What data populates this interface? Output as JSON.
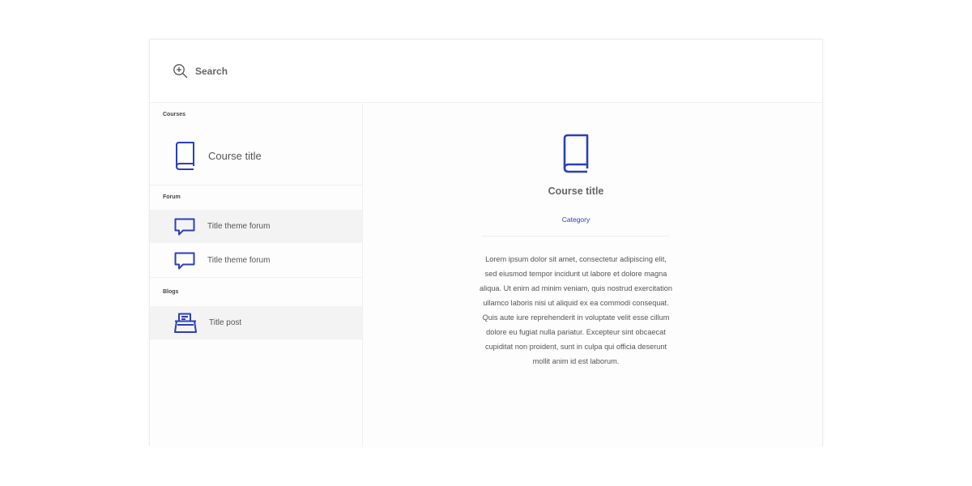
{
  "search": {
    "placeholder": "Search",
    "value": ""
  },
  "sidebar": {
    "courses": {
      "label": "Courses",
      "items": [
        {
          "title": "Course title",
          "icon": "book-icon"
        }
      ]
    },
    "forum": {
      "label": "Forum",
      "items": [
        {
          "title": "Title theme forum",
          "icon": "chat-icon",
          "active": true
        },
        {
          "title": "Title theme forum",
          "icon": "chat-icon",
          "active": false
        }
      ]
    },
    "blogs": {
      "label": "Blogs",
      "items": [
        {
          "title": "Title post",
          "icon": "typewriter-icon",
          "active": true
        }
      ]
    }
  },
  "detail": {
    "icon": "book-icon",
    "title": "Course title",
    "category": "Category",
    "description": "Lorem ipsum dolor sit amet, consectetur adipiscing elit, sed eiusmod tempor incidunt ut labore et dolore magna aliqua. Ut enim ad minim veniam, quis nostrud exercitation ullamco laboris nisi ut aliquid ex ea commodi consequat. Quis aute iure reprehenderit in voluptate velit esse cillum dolore eu fugiat nulla pariatur. Excepteur sint obcaecat cupiditat non proident, sunt in culpa qui officia deserunt mollit anim id est laborum."
  },
  "colors": {
    "accent": "#2c3fb8",
    "text": "#555555",
    "active_row": "#f3f3f3"
  }
}
